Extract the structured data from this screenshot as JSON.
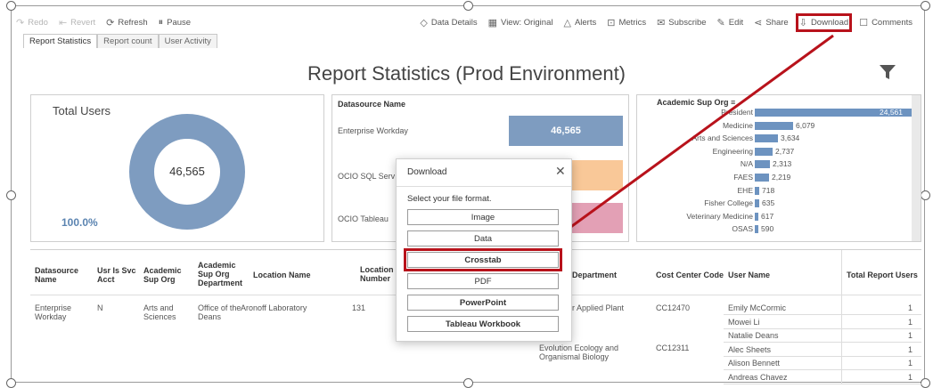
{
  "toolbar": {
    "left": [
      {
        "label": "Redo",
        "icon": "redo-icon"
      },
      {
        "label": "Revert",
        "icon": "revert-icon"
      },
      {
        "label": "Refresh",
        "icon": "refresh-icon"
      },
      {
        "label": "Pause",
        "icon": "pause-icon"
      }
    ],
    "right": [
      {
        "label": "Data Details",
        "icon": "tag-icon"
      },
      {
        "label": "View: Original",
        "icon": "view-icon"
      },
      {
        "label": "Alerts",
        "icon": "alert-icon"
      },
      {
        "label": "Metrics",
        "icon": "metrics-icon"
      },
      {
        "label": "Subscribe",
        "icon": "subscribe-icon"
      },
      {
        "label": "Edit",
        "icon": "pencil-icon"
      },
      {
        "label": "Share",
        "icon": "share-icon"
      },
      {
        "label": "Download",
        "icon": "download-icon"
      },
      {
        "label": "Comments",
        "icon": "comment-icon"
      }
    ]
  },
  "tabs": [
    "Report Statistics",
    "Report count",
    "User Activity"
  ],
  "title": "Report Statistics (Prod Environment)",
  "total_users": {
    "title": "Total Users",
    "value": "46,565",
    "percent": "100.0%"
  },
  "datasource": {
    "header": "Datasource Name",
    "rows": [
      {
        "name": "Enterprise Workday",
        "value": "46,565",
        "color": "#7e9cc0"
      },
      {
        "name": "OCIO SQL Serv",
        "value": "",
        "color": "#f9c898"
      },
      {
        "name": "OCIO Tableau",
        "value": "",
        "color": "#e3a0b5"
      }
    ]
  },
  "academic": {
    "header": "Academic Sup Org",
    "rows": [
      {
        "label": "President",
        "value": "24,561",
        "frac": 1.0
      },
      {
        "label": "Medicine",
        "value": "6,079",
        "frac": 0.247
      },
      {
        "label": "Arts and Sciences",
        "value": "3,634",
        "frac": 0.148
      },
      {
        "label": "Engineering",
        "value": "2,737",
        "frac": 0.111
      },
      {
        "label": "N/A",
        "value": "2,313",
        "frac": 0.094
      },
      {
        "label": "FAES",
        "value": "2,219",
        "frac": 0.09
      },
      {
        "label": "EHE",
        "value": "718",
        "frac": 0.029
      },
      {
        "label": "Fisher College",
        "value": "635",
        "frac": 0.026
      },
      {
        "label": "Veterinary Medicine",
        "value": "617",
        "frac": 0.025
      },
      {
        "label": "OSAS",
        "value": "590",
        "frac": 0.024
      }
    ]
  },
  "table": {
    "headers": {
      "datasource": "Datasource Name",
      "svc": "Usr Is Svc Acct",
      "acad": "Academic Sup Org",
      "dept": "Academic Sup Org Department",
      "loc": "Location Name",
      "locnum": "Location Number",
      "dept2": "Department",
      "cost": "Cost Center Code",
      "user": "User Name",
      "total": "Total Report Users"
    },
    "row1": {
      "datasource": "Enterprise Workday",
      "svc": "N",
      "acad": "Arts and Sciences",
      "dept": "Office of the Deans",
      "loc": "Aronoff Laboratory",
      "locnum": "131"
    },
    "groups": [
      {
        "dept": "r Applied Plant",
        "cost": "CC12470"
      },
      {
        "dept": "Evolution Ecology and Organismal Biology",
        "cost": "CC12311"
      }
    ],
    "users": [
      {
        "name": "Emily McCormic",
        "count": "1"
      },
      {
        "name": "Mowei Li",
        "count": "1"
      },
      {
        "name": "Natalie Deans",
        "count": "1"
      },
      {
        "name": "Alec Sheets",
        "count": "1"
      },
      {
        "name": "Alison Bennett",
        "count": "1"
      },
      {
        "name": "Andreas Chavez",
        "count": "1"
      }
    ]
  },
  "dialog": {
    "title": "Download",
    "subtitle": "Select your file format.",
    "options": [
      "Image",
      "Data",
      "Crosstab",
      "PDF",
      "PowerPoint",
      "Tableau Workbook"
    ]
  },
  "colors": {
    "accent": "#b8121b",
    "bar": "#6d93c0",
    "donut": "#7e9cc0"
  }
}
